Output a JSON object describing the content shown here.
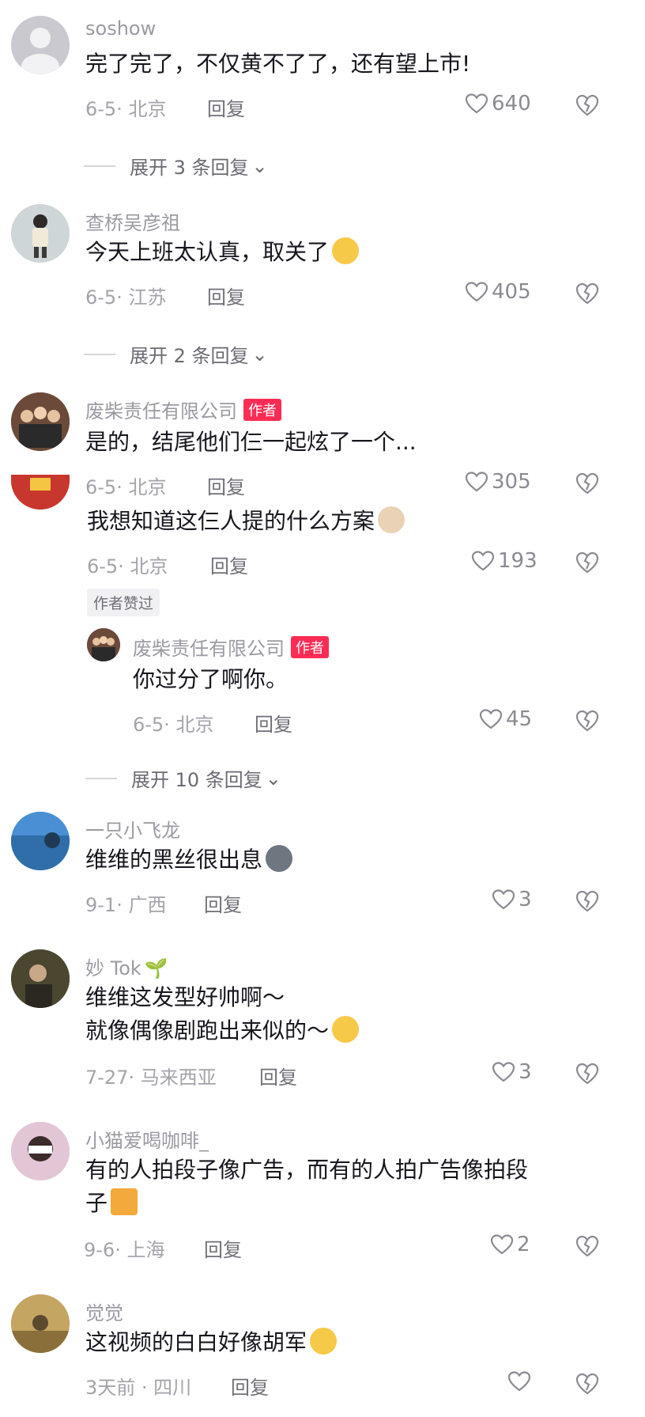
{
  "comments": [
    {
      "user": "soshow",
      "text": "完了完了，不仅黄不了了，还有望上市!",
      "date": "6-5",
      "location": "北京",
      "reply": "回复",
      "likes": "640",
      "expand": "展开 3 条回复"
    },
    {
      "user": "查桥吴彦祖",
      "text": "今天上班太认真，取关了",
      "date": "6-5",
      "location": "江苏",
      "reply": "回复",
      "likes": "405",
      "expand": "展开 2 条回复"
    },
    {
      "user": "废柴责任有限公司",
      "badge": "作者",
      "text": "是的，结尾他们仨一起炫了一个...",
      "date": "6-5",
      "location": "北京",
      "reply": "回复",
      "likes": "305"
    },
    {
      "text": "我想知道这仨人提的什么方案",
      "date": "6-5",
      "location": "北京",
      "reply": "回复",
      "likes": "193",
      "author_liked": "作者赞过",
      "sub_reply": {
        "user": "废柴责任有限公司",
        "badge": "作者",
        "text": "你过分了啊你。",
        "date": "6-5",
        "location": "北京",
        "reply": "回复",
        "likes": "45"
      },
      "expand": "展开 10 条回复"
    },
    {
      "user": "一只小飞龙",
      "text": "维维的黑丝很出息",
      "date": "9-1",
      "location": "广西",
      "reply": "回复",
      "likes": "3"
    },
    {
      "user": "妙 Tok",
      "text_line1": "维维这发型好帅啊～",
      "text_line2": "就像偶像剧跑出来似的～",
      "date": "7-27",
      "location": "马来西亚",
      "reply": "回复",
      "likes": "3"
    },
    {
      "user": "小猫爱喝咖啡_",
      "text_line1": "有的人拍段子像广告，而有的人拍广告像拍段",
      "text_line2": "子",
      "date": "9-6",
      "location": "上海",
      "reply": "回复",
      "likes": "2"
    },
    {
      "user": "觉觉",
      "text": "这视频的白白好像胡军",
      "date": "3天前",
      "location": "四川",
      "reply": "回复",
      "likes": ""
    }
  ],
  "colors": {
    "accent": "#fe2c55",
    "text": "#16161d",
    "muted": "#a3a3aa"
  }
}
